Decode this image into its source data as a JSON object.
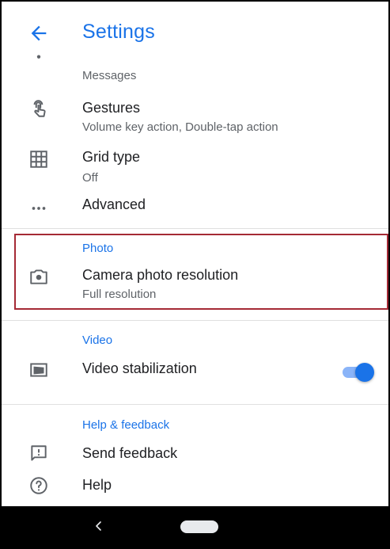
{
  "appbar": {
    "title": "Settings"
  },
  "partial_item": {
    "subtitle": "Messages"
  },
  "items": {
    "gestures": {
      "label": "Gestures",
      "subtitle": "Volume key action, Double-tap action"
    },
    "grid": {
      "label": "Grid type",
      "subtitle": "Off"
    },
    "advanced": {
      "label": "Advanced"
    }
  },
  "photo": {
    "header": "Photo",
    "resolution": {
      "label": "Camera photo resolution",
      "subtitle": "Full resolution"
    }
  },
  "video": {
    "header": "Video",
    "stabilization": {
      "label": "Video stabilization",
      "enabled": true
    }
  },
  "help": {
    "header": "Help & feedback",
    "send_feedback": "Send feedback",
    "help": "Help"
  },
  "colors": {
    "accent": "#1a73e8",
    "highlight_border": "#a52a35",
    "navbar": "#000000"
  }
}
